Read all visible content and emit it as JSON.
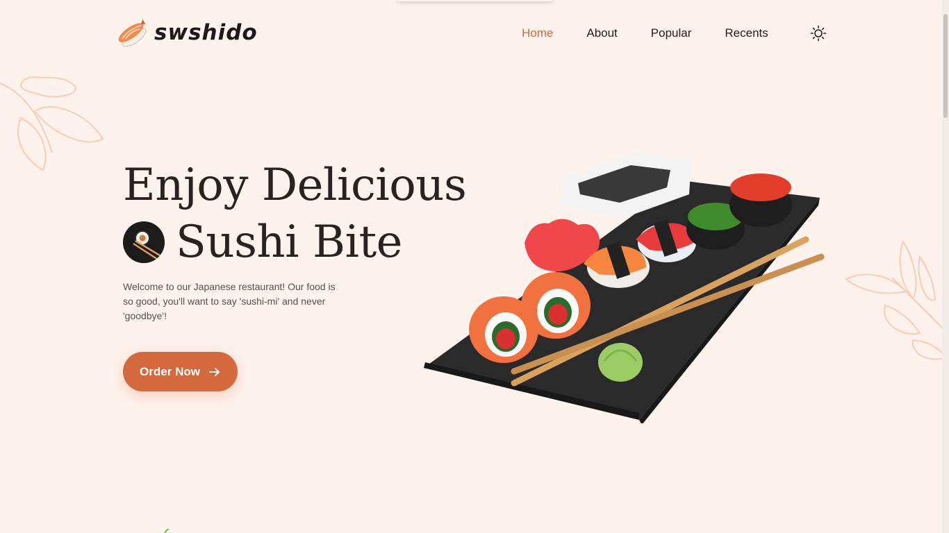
{
  "brand": {
    "name": "swshido",
    "logo_icon": "shrimp-nigiri-icon"
  },
  "nav": {
    "items": [
      {
        "label": "Home",
        "active": true
      },
      {
        "label": "About",
        "active": false
      },
      {
        "label": "Popular",
        "active": false
      },
      {
        "label": "Recents",
        "active": false
      }
    ],
    "theme_toggle_icon": "sun-icon"
  },
  "hero": {
    "title_line1": "Enjoy Delicious",
    "title_line2": "Sushi Bite",
    "description": "Welcome to our Japanese restaurant! Our food is so good, you'll want to say 'sushi-mi' and never 'goodbye'!",
    "cta_label": "Order Now",
    "cta_icon": "arrow-right-icon",
    "image": "sushi-platter-image"
  },
  "colors": {
    "accent": "#d3693d",
    "background": "#fef2ec",
    "text": "#2a2220"
  }
}
